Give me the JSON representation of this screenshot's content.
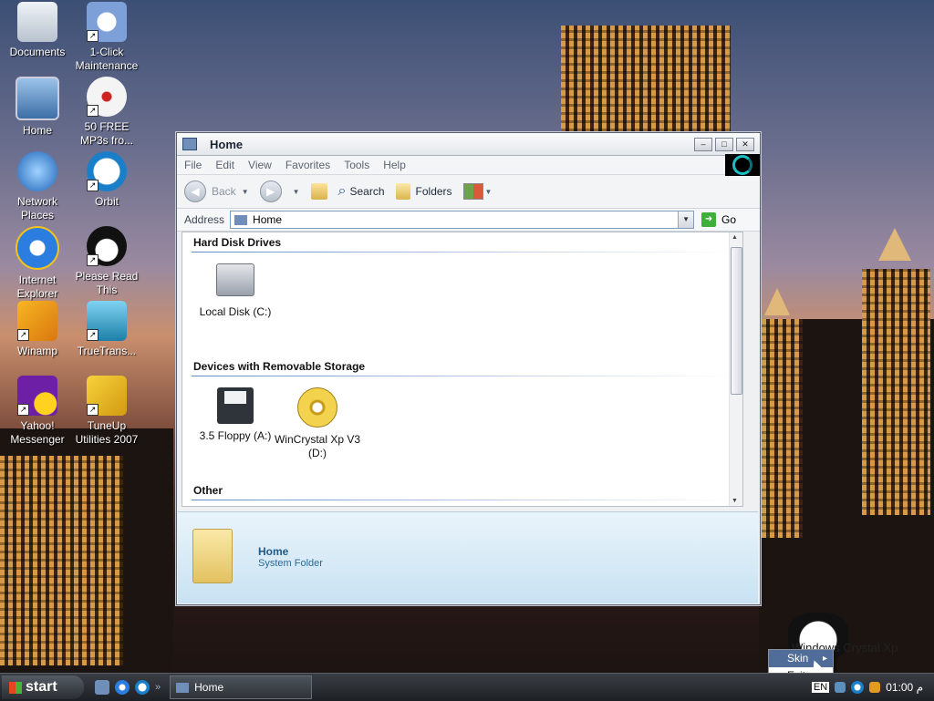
{
  "desktop": {
    "icons": [
      {
        "label": "Documents"
      },
      {
        "label": "1-Click Maintenance"
      },
      {
        "label": "Home"
      },
      {
        "label": "50 FREE MP3s fro..."
      },
      {
        "label": "Network Places"
      },
      {
        "label": "Orbit"
      },
      {
        "label": "Internet Explorer"
      },
      {
        "label": "Please Read This"
      },
      {
        "label": "Winamp"
      },
      {
        "label": "TrueTrans..."
      },
      {
        "label": "Yahoo! Messenger"
      },
      {
        "label": "TuneUp Utilities 2007"
      }
    ]
  },
  "window": {
    "title": "Home",
    "menu": [
      "File",
      "Edit",
      "View",
      "Favorites",
      "Tools",
      "Help"
    ],
    "toolbar": {
      "back": "Back",
      "search": "Search",
      "folders": "Folders"
    },
    "address": {
      "label": "Address",
      "value": "Home",
      "go": "Go"
    },
    "groups": [
      {
        "title": "Hard Disk Drives",
        "items": [
          {
            "label": "Local Disk (C:)"
          }
        ]
      },
      {
        "title": "Devices with Removable Storage",
        "items": [
          {
            "label": "3.5 Floppy (A:)"
          },
          {
            "label": "WinCrystal Xp V3 (D:)"
          }
        ]
      },
      {
        "title": "Other",
        "items": []
      }
    ],
    "details": {
      "title": "Home",
      "subtitle": "System Folder"
    }
  },
  "widget": {
    "text": "Windows Crystal Xp"
  },
  "context_menu": {
    "items": [
      "Skin",
      "Exit"
    ],
    "highlighted": "Skin"
  },
  "taskbar": {
    "start": "start",
    "task": "Home",
    "lang": "EN",
    "clock": "01:00 م"
  },
  "colors": {
    "accent": "#4f6d98",
    "details_title": "#1e5a8a",
    "taskbar": "#2a2e33"
  }
}
